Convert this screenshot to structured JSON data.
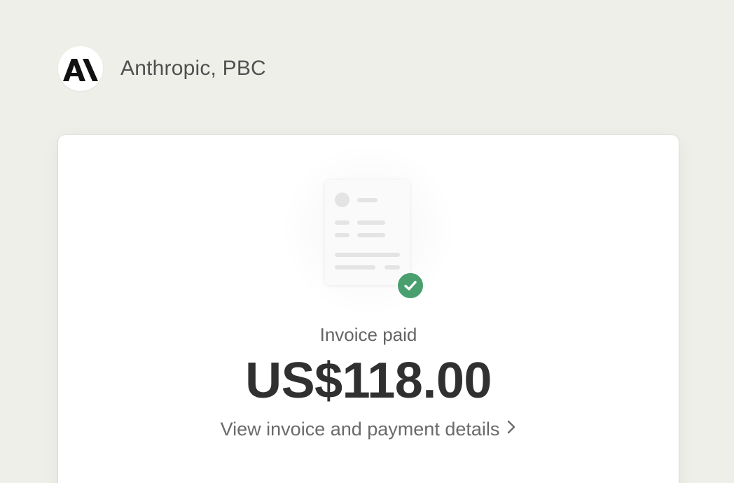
{
  "merchant": {
    "name": "Anthropic, PBC",
    "logo_icon": "anthropic-logo-icon"
  },
  "invoice": {
    "status_label": "Invoice paid",
    "amount": "US$118.00",
    "details_link_label": "View invoice and payment details",
    "illustration_icon": "invoice-document-icon",
    "status_icon": "check-circle-icon"
  },
  "colors": {
    "background": "#efefea",
    "card": "#ffffff",
    "success": "#4a9f6f",
    "text_primary": "#303030",
    "text_secondary": "#646464"
  }
}
